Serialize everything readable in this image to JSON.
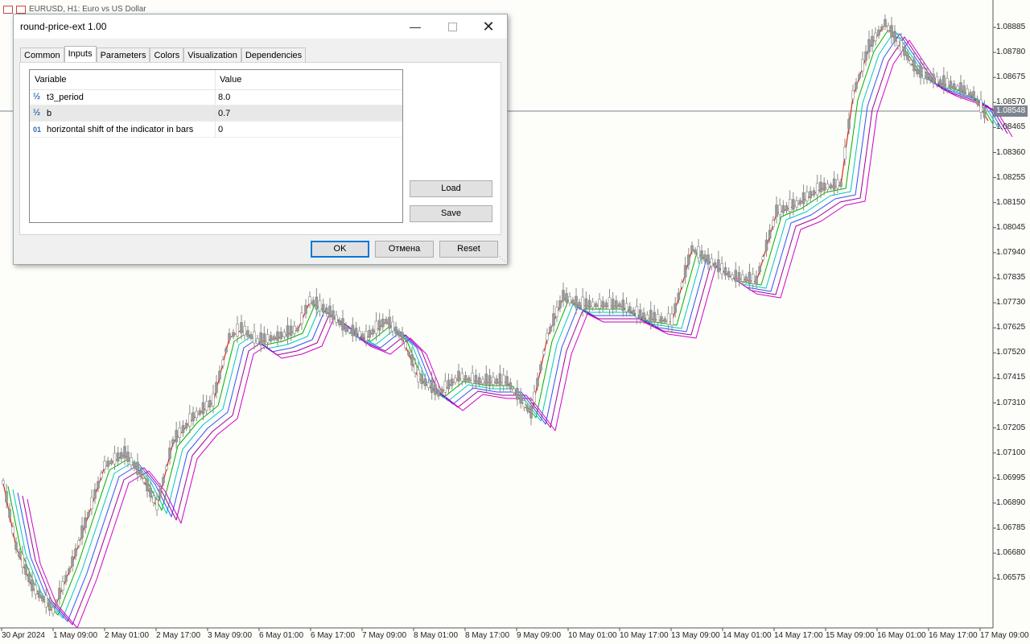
{
  "chart": {
    "title": "EURUSD, H1:  Euro vs US Dollar",
    "current_price": "1.08548",
    "price_levels": [
      "1.08885",
      "1.08780",
      "1.08675",
      "1.08570",
      "1.08465",
      "1.08360",
      "1.08255",
      "1.08150",
      "1.08045",
      "1.07940",
      "1.07835",
      "1.07730",
      "1.07625",
      "1.07520",
      "1.07415",
      "1.07310",
      "1.07205",
      "1.07100",
      "1.06995",
      "1.06890",
      "1.06785",
      "1.06680",
      "1.06575"
    ],
    "time_labels": [
      "30 Apr 2024",
      "1 May 09:00",
      "2 May 01:00",
      "2 May 17:00",
      "3 May 09:00",
      "6 May 01:00",
      "6 May 17:00",
      "7 May 09:00",
      "8 May 01:00",
      "8 May 17:00",
      "9 May 09:00",
      "10 May 01:00",
      "10 May 17:00",
      "13 May 09:00",
      "14 May 01:00",
      "14 May 17:00",
      "15 May 09:00",
      "16 May 01:00",
      "16 May 17:00",
      "17 May 09:00"
    ],
    "ribbon_colors": [
      "#e8c000",
      "#d01010",
      "#00b000",
      "#00c8c8",
      "#3050ff",
      "#a000a0",
      "#d000d0"
    ]
  },
  "dialog": {
    "title": "round-price-ext 1.00",
    "tabs": [
      "Common",
      "Inputs",
      "Parameters",
      "Colors",
      "Visualization",
      "Dependencies"
    ],
    "active_tab": "Inputs",
    "grid": {
      "col_variable": "Variable",
      "col_value": "Value",
      "rows": [
        {
          "icon": "½",
          "variable": "t3_period",
          "value": "8.0"
        },
        {
          "icon": "½",
          "variable": "b",
          "value": "0.7"
        },
        {
          "icon": "01",
          "variable": "horizontal shift of the indicator in bars",
          "value": "0"
        }
      ]
    },
    "load_label": "Load",
    "save_label": "Save",
    "ok_label": "OK",
    "cancel_label": "Отмена",
    "reset_label": "Reset"
  }
}
